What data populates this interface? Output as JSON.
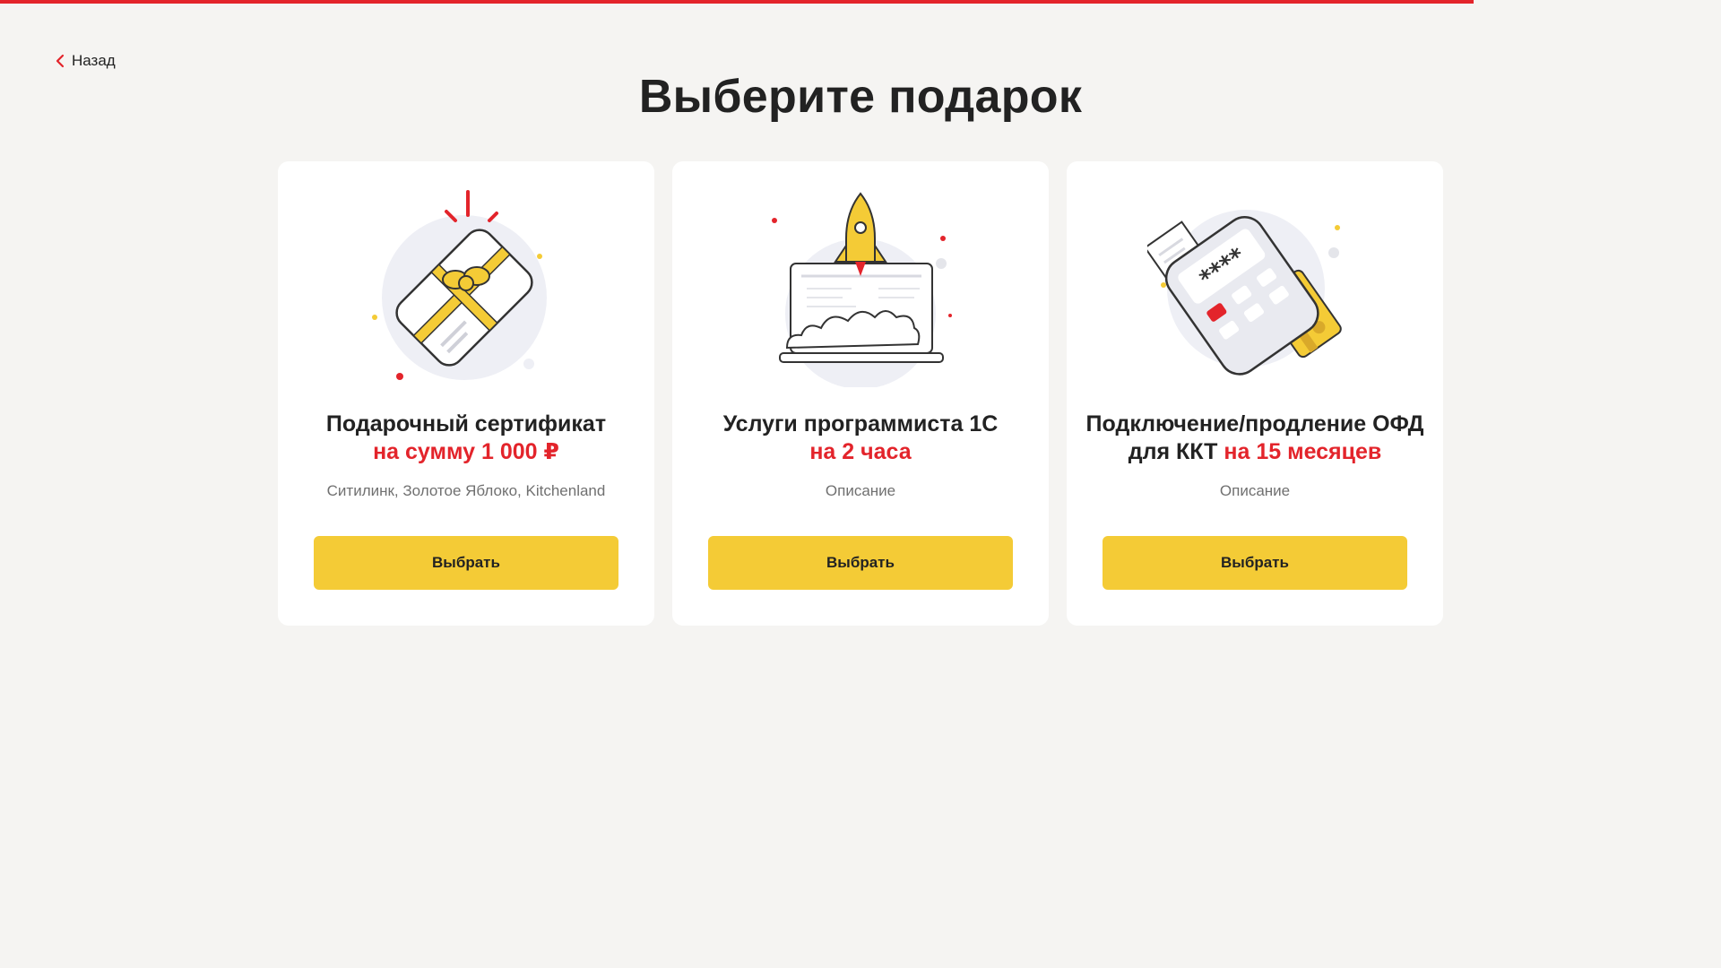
{
  "progress": {
    "percent": 85.6,
    "color": "#e3242b"
  },
  "nav": {
    "back_label": "Назад"
  },
  "page": {
    "title": "Выберите подарок"
  },
  "colors": {
    "accent": "#e3242b",
    "button": "#f4cb36",
    "background": "#f5f4f2"
  },
  "cards": [
    {
      "title_main": "Подарочный сертификат",
      "title_accent": "на сумму 1 000 ₽",
      "description": "Ситилинк, Золотое Яблоко, Kitchenland",
      "button_label": "Выбрать",
      "icon": "gift-card-icon"
    },
    {
      "title_main": "Услуги программиста 1С",
      "title_accent": "на 2 часа",
      "description": "Описание",
      "button_label": "Выбрать",
      "icon": "rocket-laptop-icon"
    },
    {
      "title_main": "Подключение/продление ОФД для ККТ",
      "title_accent": "на 15 месяцев",
      "description": "Описание",
      "button_label": "Выбрать",
      "icon": "payment-terminal-icon"
    }
  ]
}
